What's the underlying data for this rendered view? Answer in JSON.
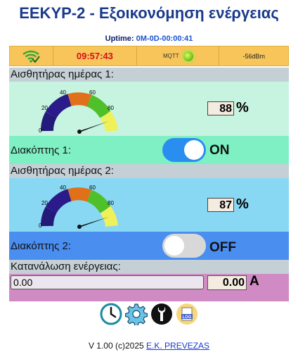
{
  "title": "EEKYP-2 - Εξοικονόμηση ενέργειας",
  "uptime": {
    "label": "Uptime:",
    "value": "0M-0D-00:00:41"
  },
  "status": {
    "time": "09:57:43",
    "mqtt_label": "MQTT",
    "signal": "-56dBm"
  },
  "sensor1": {
    "label": "Αισθητήρας ημέρας 1:",
    "value": "88",
    "unit": "%",
    "gauge_ticks": [
      "0",
      "20",
      "40",
      "60",
      "80"
    ]
  },
  "switch1": {
    "label": "Διακόπτης 1:",
    "state": "ON",
    "on": true
  },
  "sensor2": {
    "label": "Αισθητήρας ημέρας 2:",
    "value": "87",
    "unit": "%",
    "gauge_ticks": [
      "0",
      "20",
      "40",
      "60",
      "80"
    ]
  },
  "switch2": {
    "label": "Διακόπτης 2:",
    "state": "OFF",
    "on": false
  },
  "energy": {
    "label": "Κατανάλωση ενέργειας:",
    "bar_text": "0.00",
    "value": "0.00",
    "unit": "A"
  },
  "toolbar": {
    "icons": [
      "clock-icon",
      "gear-icon",
      "wrench-icon",
      "log-icon"
    ],
    "log_text": "LOG"
  },
  "footer": {
    "text": "V 1.00 (c)2025 ",
    "link": "E.K. PREVEZAS"
  },
  "colors": {
    "sensor1_bg": "#c6f4e0",
    "switch1_bg": "#7ef0c4",
    "sensor2_bg": "#88d8f4",
    "switch2_bg": "#4a8ef0",
    "toggle_on": "#2a8ef0",
    "toggle_off": "#d8d8d8"
  }
}
